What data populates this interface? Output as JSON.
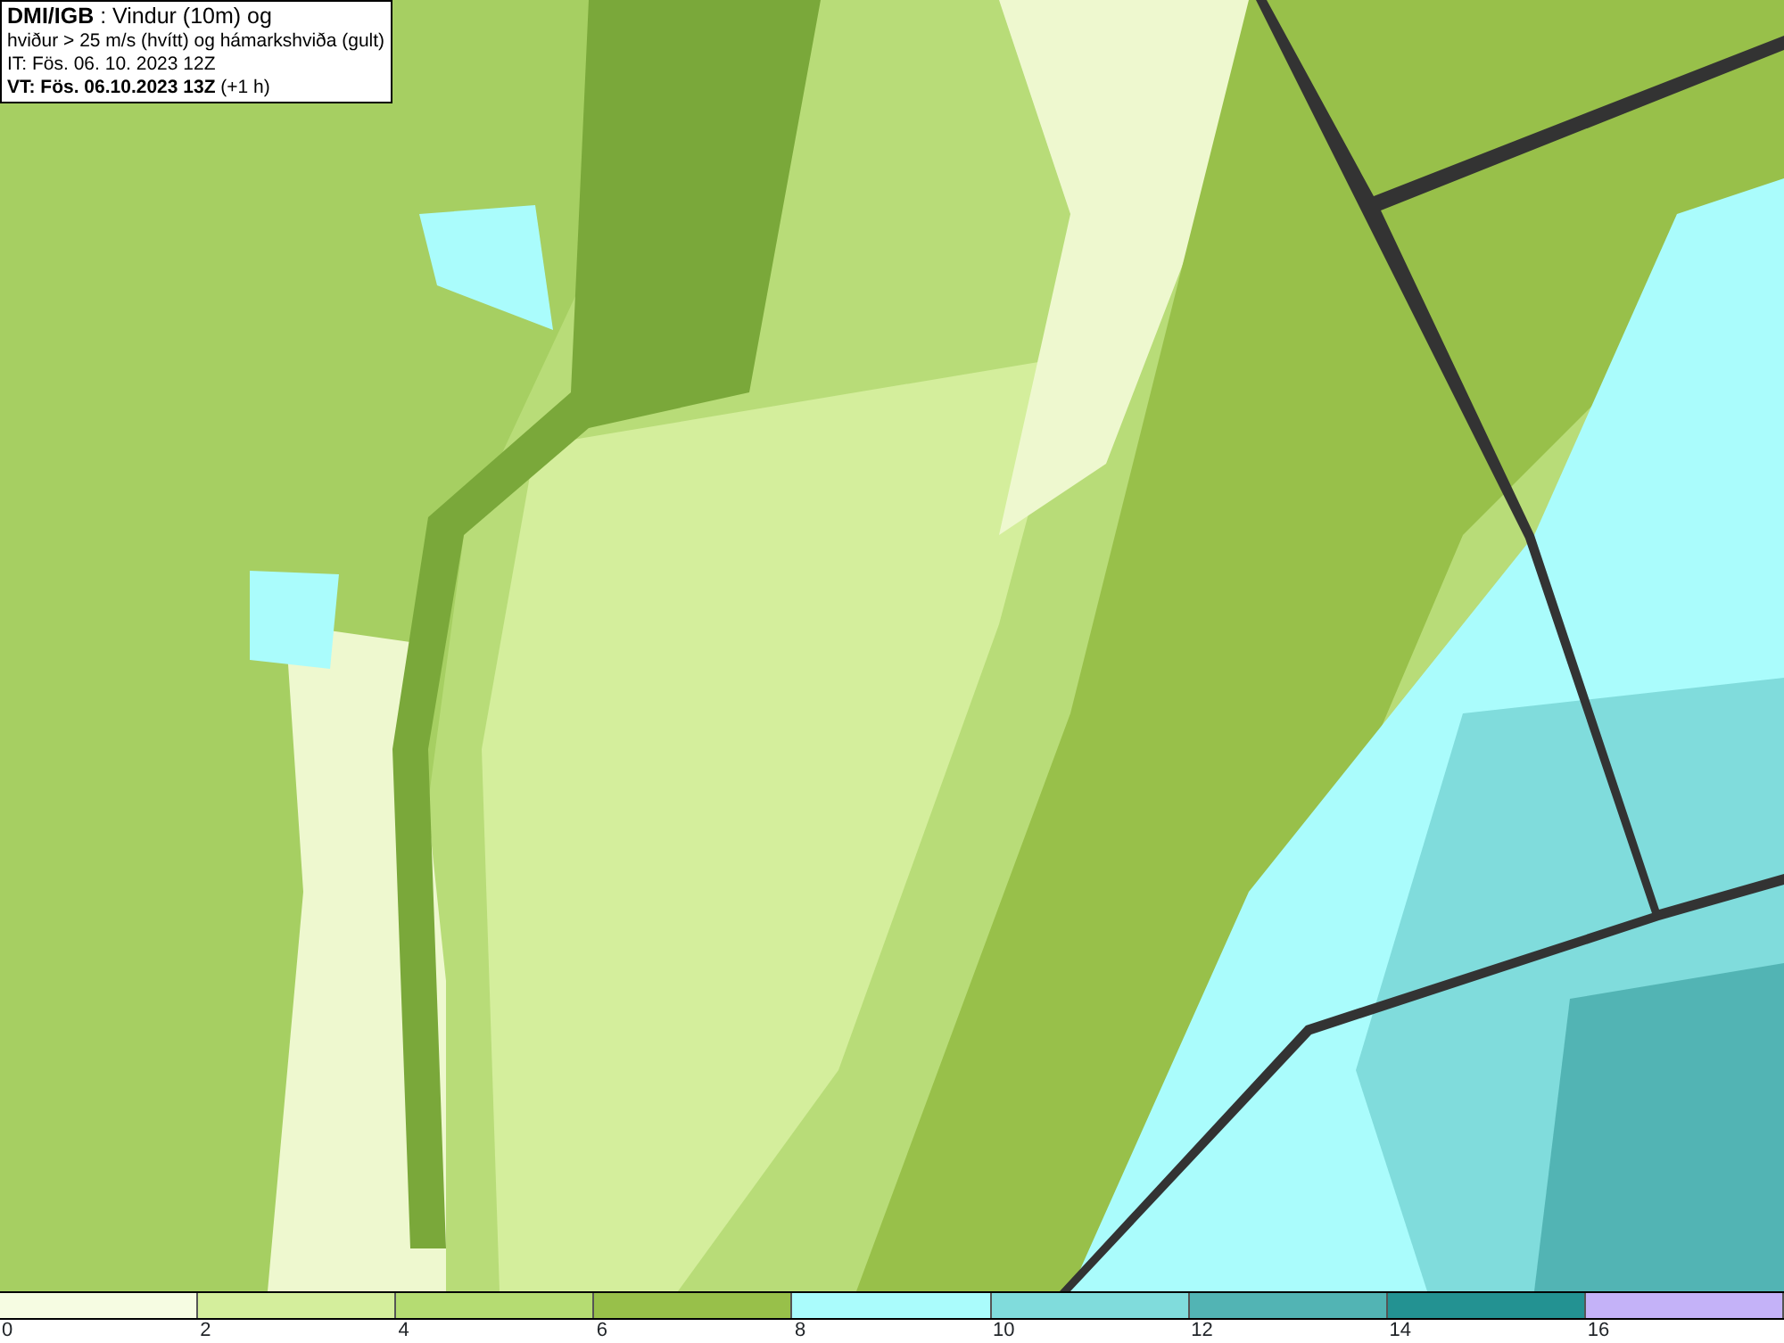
{
  "title_box": {
    "lines": [
      "**DMI/IGB** : Vindur (10m) og",
      "hviður > 25 m/s (hvítt) og hámarkshviða (gult)",
      "IT: Fös. 06. 10. 2023 12Z",
      "**VT: Fös. 06.10.2023 13Z** (+1 h)"
    ]
  },
  "legend": {
    "bins": [
      {
        "color": "#f6fce2"
      },
      {
        "color": "#d4ee9c"
      },
      {
        "color": "#b5dc72"
      },
      {
        "color": "#98c04a"
      },
      {
        "color": "#aafcfc"
      },
      {
        "color": "#80dcdc"
      },
      {
        "color": "#52b4b4"
      },
      {
        "color": "#239292"
      },
      {
        "color": "#c4b2f8"
      }
    ],
    "ticks": [
      "0",
      "2",
      "4",
      "6",
      "8",
      "10",
      "12",
      "14",
      "16"
    ]
  }
}
